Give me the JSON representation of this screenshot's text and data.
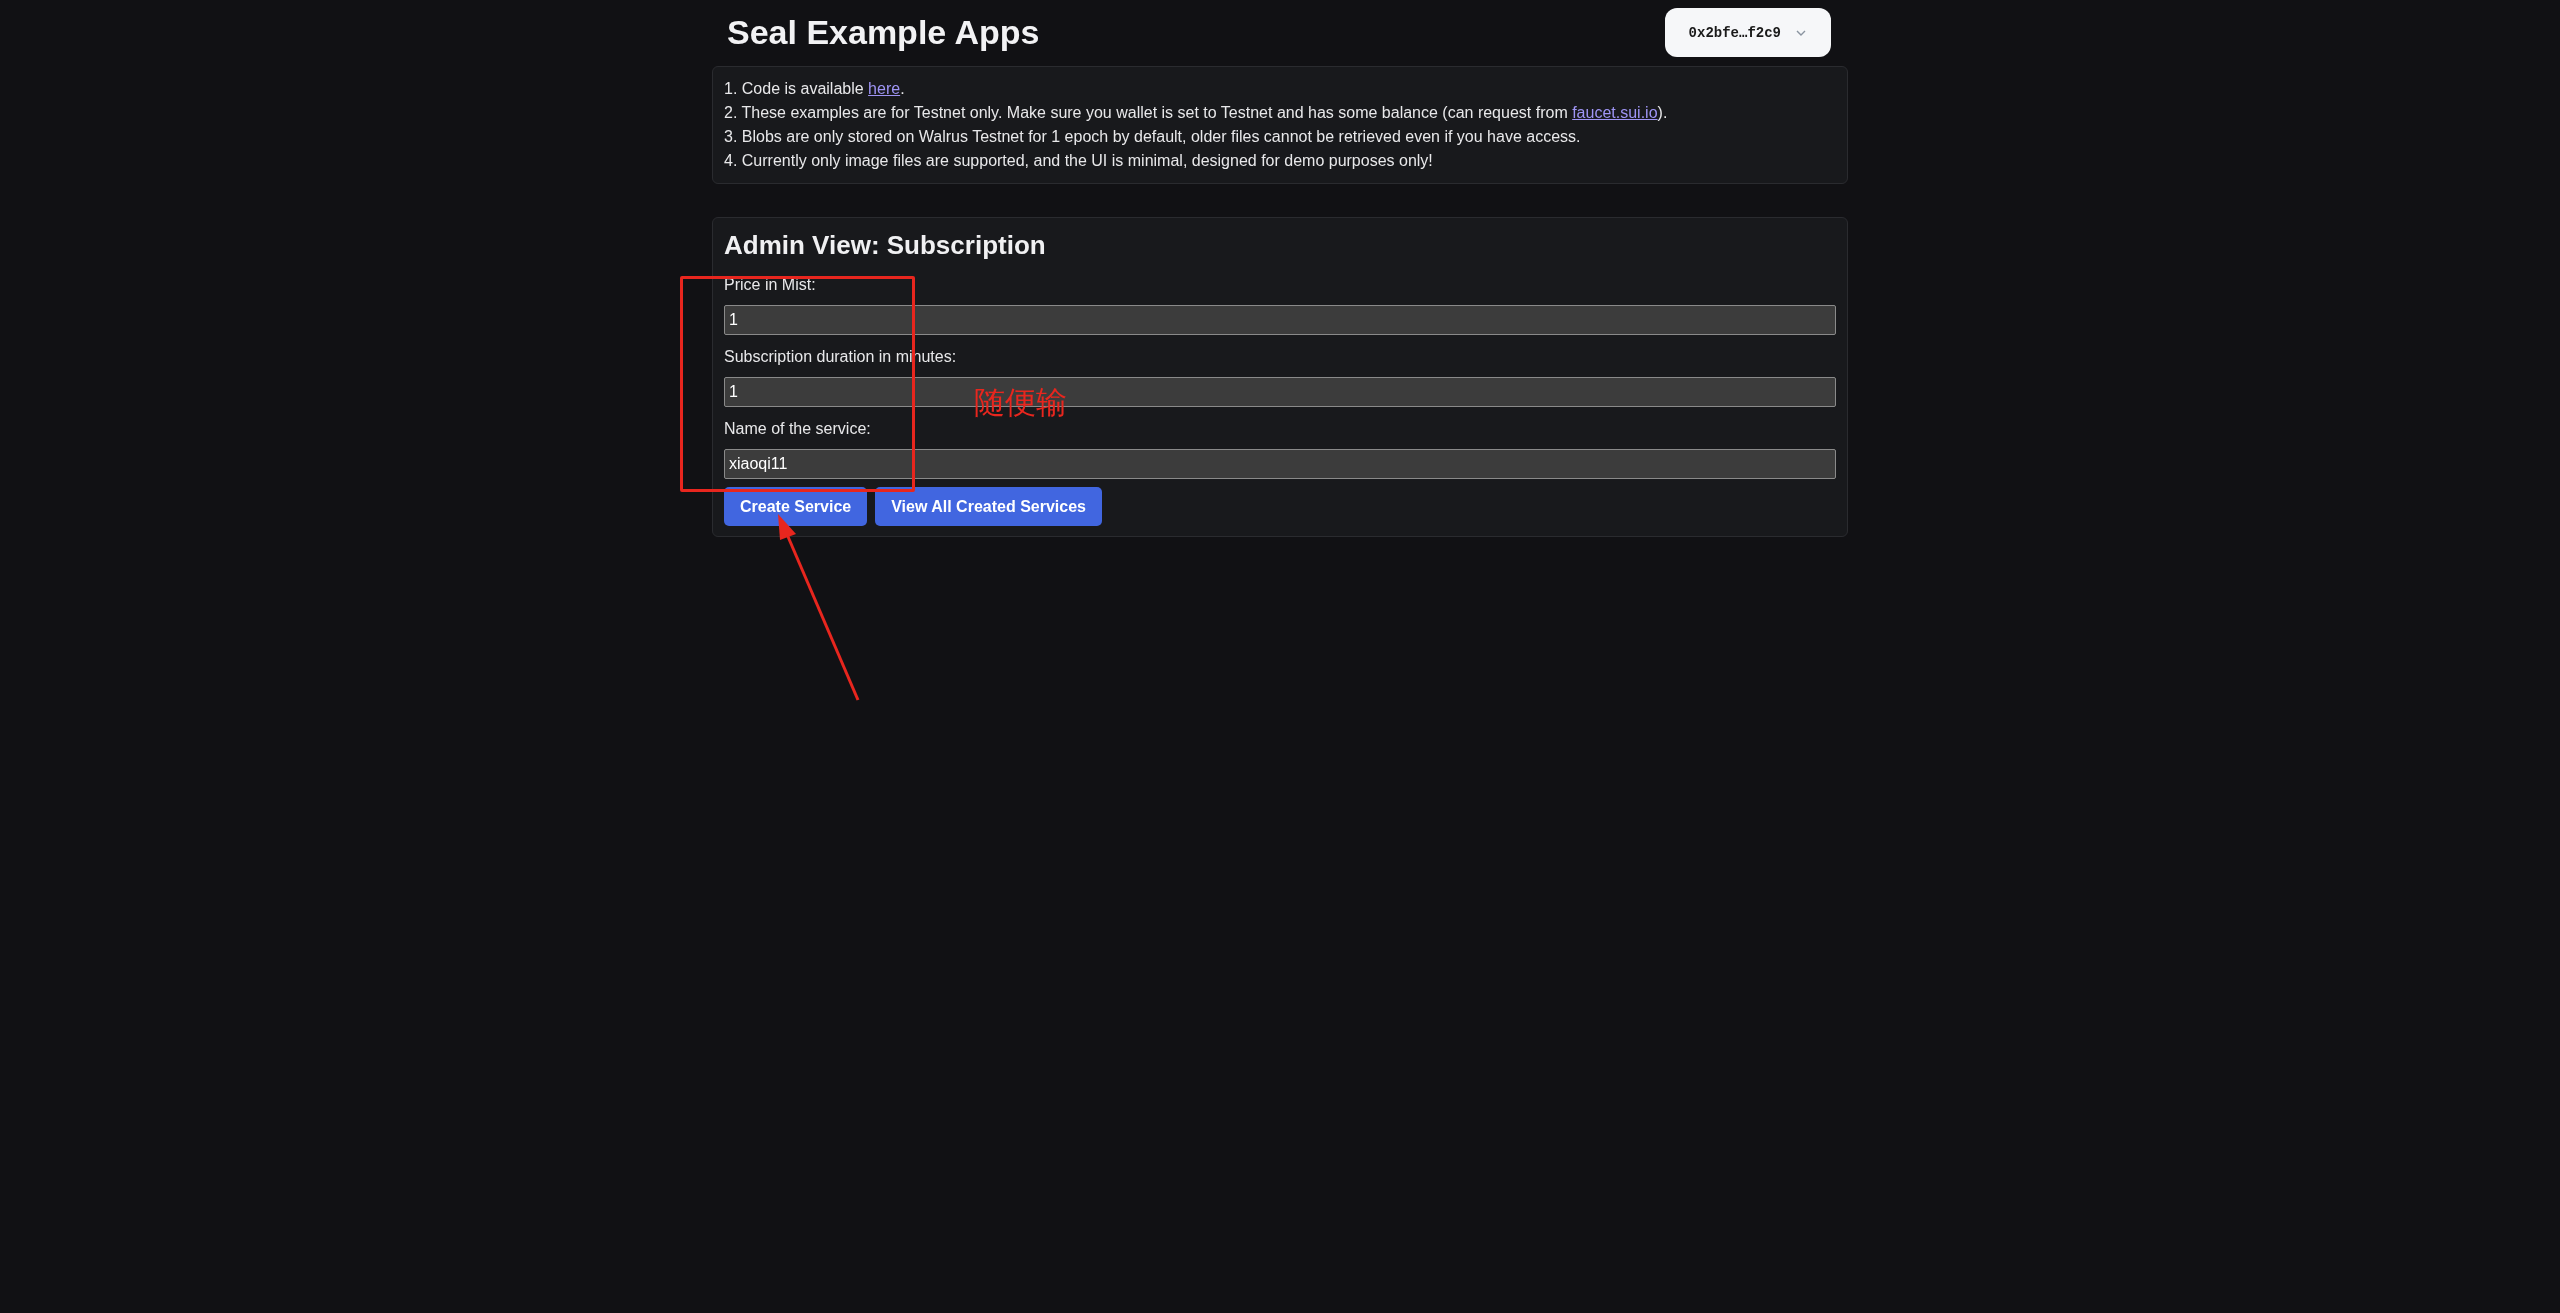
{
  "header": {
    "title": "Seal Example Apps",
    "wallet_button": "0x2bfe…f2c9"
  },
  "notes": [
    {
      "before": "1. Code is available ",
      "link": "here",
      "after": "."
    },
    {
      "before": "2. These examples are for Testnet only. Make sure you wallet is set to Testnet and has some balance (can request from ",
      "link": "faucet.sui.io",
      "after": ")."
    },
    {
      "before": "3. Blobs are only stored on Walrus Testnet for 1 epoch by default, older files cannot be retrieved even if you have access."
    },
    {
      "before": "4. Currently only image files are supported, and the UI is minimal, designed for demo purposes only!"
    }
  ],
  "form": {
    "title": "Admin View: Subscription",
    "fields": [
      {
        "label": "Price in Mist:",
        "value": "1"
      },
      {
        "label": "Subscription duration in minutes:",
        "value": "1"
      },
      {
        "label": "Name of the service:",
        "value": "xiaoqi11"
      }
    ],
    "buttons": [
      "Create Service",
      "View All Created Services"
    ]
  },
  "annotation": {
    "text": "随便输"
  }
}
